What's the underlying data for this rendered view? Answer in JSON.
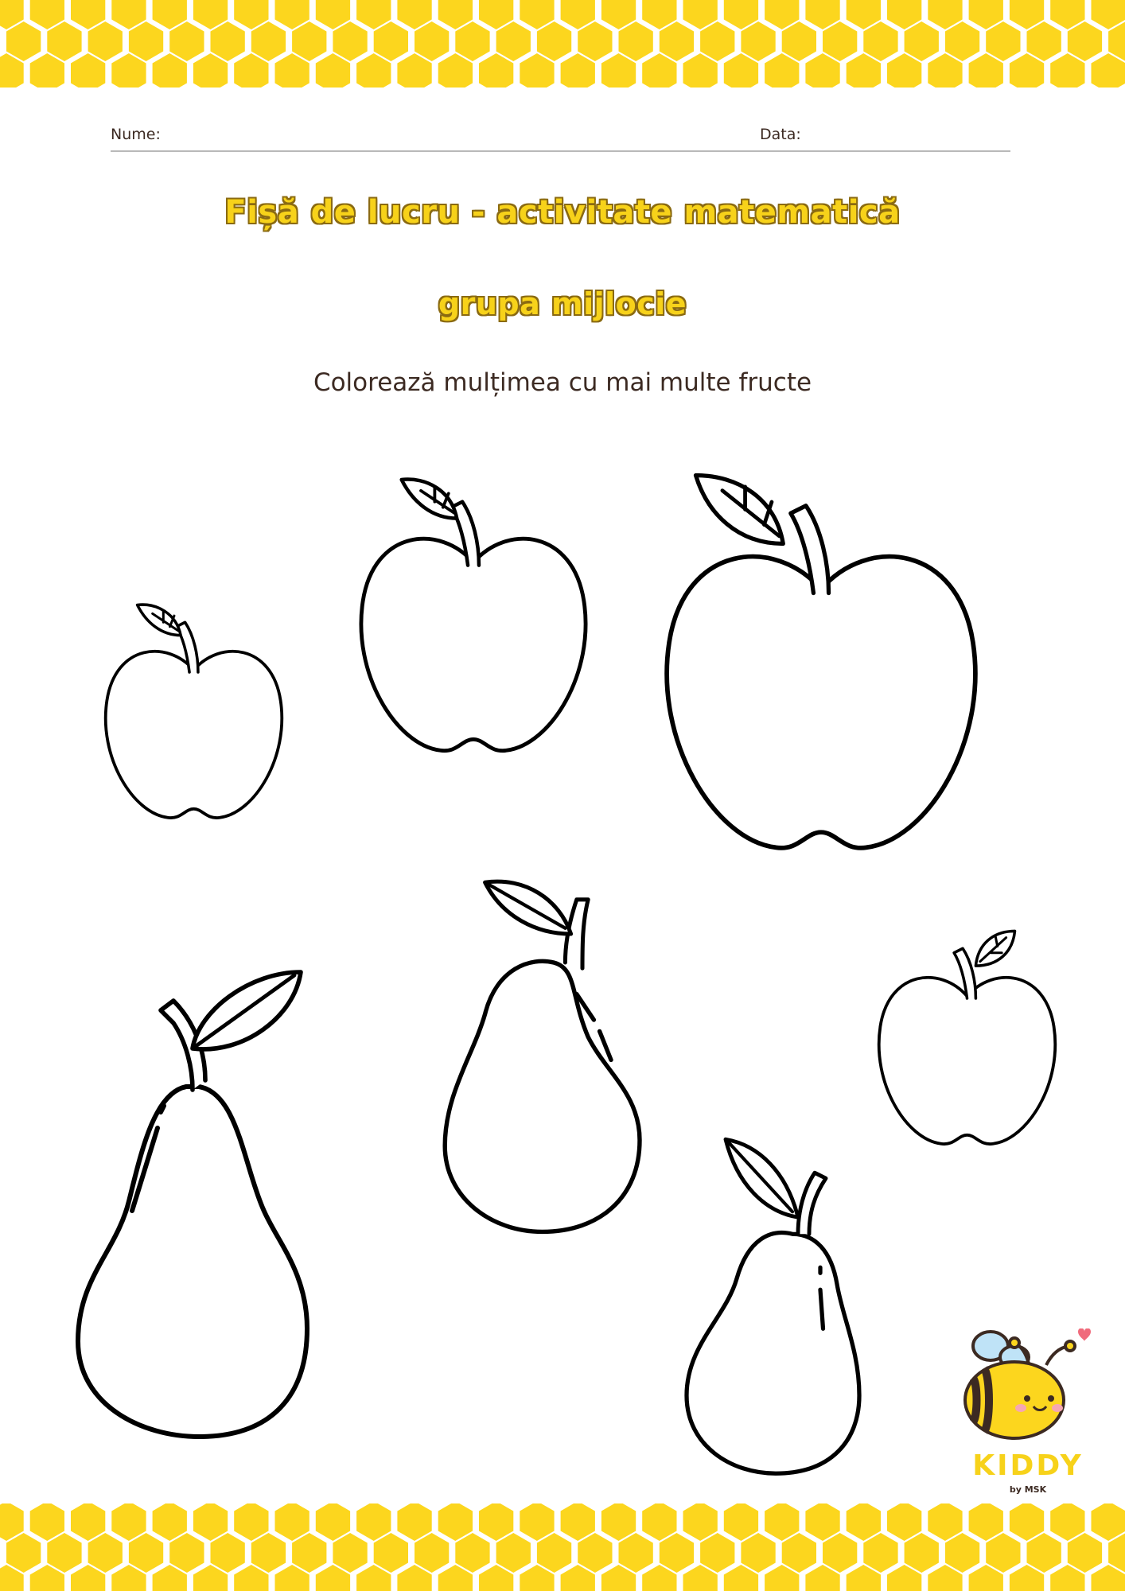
{
  "header": {
    "name_label": "Nume:",
    "date_label": "Data:"
  },
  "title": "Fișă de lucru - activitate matematică",
  "subtitle": "grupa mijlocie",
  "instruction": "Colorează mulțimea cu mai multe fructe",
  "fruits": {
    "apples": 4,
    "pears": 3
  },
  "logo": {
    "name": "KIDDY",
    "byline": "by MSK",
    "icon": "bee-icon"
  },
  "colors": {
    "honeycomb": "#fcd61e",
    "title_fill": "#f7d21a",
    "title_outline": "#8a6a12",
    "text": "#3c2a22"
  }
}
